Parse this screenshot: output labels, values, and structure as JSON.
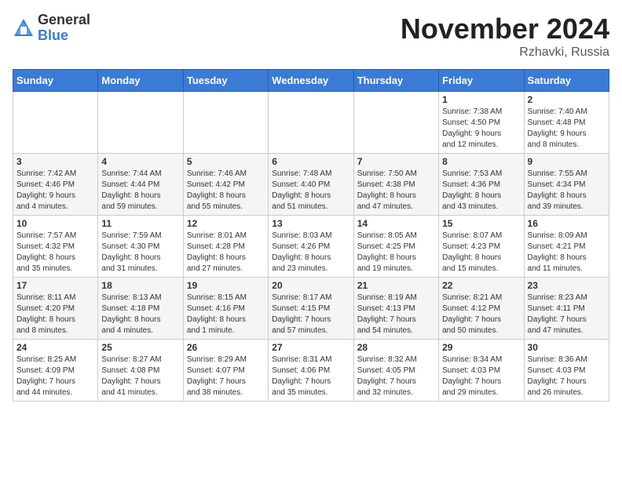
{
  "header": {
    "logo_general": "General",
    "logo_blue": "Blue",
    "month_title": "November 2024",
    "location": "Rzhavki, Russia"
  },
  "weekdays": [
    "Sunday",
    "Monday",
    "Tuesday",
    "Wednesday",
    "Thursday",
    "Friday",
    "Saturday"
  ],
  "weeks": [
    [
      {
        "day": "",
        "info": ""
      },
      {
        "day": "",
        "info": ""
      },
      {
        "day": "",
        "info": ""
      },
      {
        "day": "",
        "info": ""
      },
      {
        "day": "",
        "info": ""
      },
      {
        "day": "1",
        "info": "Sunrise: 7:38 AM\nSunset: 4:50 PM\nDaylight: 9 hours\nand 12 minutes."
      },
      {
        "day": "2",
        "info": "Sunrise: 7:40 AM\nSunset: 4:48 PM\nDaylight: 9 hours\nand 8 minutes."
      }
    ],
    [
      {
        "day": "3",
        "info": "Sunrise: 7:42 AM\nSunset: 4:46 PM\nDaylight: 9 hours\nand 4 minutes."
      },
      {
        "day": "4",
        "info": "Sunrise: 7:44 AM\nSunset: 4:44 PM\nDaylight: 8 hours\nand 59 minutes."
      },
      {
        "day": "5",
        "info": "Sunrise: 7:46 AM\nSunset: 4:42 PM\nDaylight: 8 hours\nand 55 minutes."
      },
      {
        "day": "6",
        "info": "Sunrise: 7:48 AM\nSunset: 4:40 PM\nDaylight: 8 hours\nand 51 minutes."
      },
      {
        "day": "7",
        "info": "Sunrise: 7:50 AM\nSunset: 4:38 PM\nDaylight: 8 hours\nand 47 minutes."
      },
      {
        "day": "8",
        "info": "Sunrise: 7:53 AM\nSunset: 4:36 PM\nDaylight: 8 hours\nand 43 minutes."
      },
      {
        "day": "9",
        "info": "Sunrise: 7:55 AM\nSunset: 4:34 PM\nDaylight: 8 hours\nand 39 minutes."
      }
    ],
    [
      {
        "day": "10",
        "info": "Sunrise: 7:57 AM\nSunset: 4:32 PM\nDaylight: 8 hours\nand 35 minutes."
      },
      {
        "day": "11",
        "info": "Sunrise: 7:59 AM\nSunset: 4:30 PM\nDaylight: 8 hours\nand 31 minutes."
      },
      {
        "day": "12",
        "info": "Sunrise: 8:01 AM\nSunset: 4:28 PM\nDaylight: 8 hours\nand 27 minutes."
      },
      {
        "day": "13",
        "info": "Sunrise: 8:03 AM\nSunset: 4:26 PM\nDaylight: 8 hours\nand 23 minutes."
      },
      {
        "day": "14",
        "info": "Sunrise: 8:05 AM\nSunset: 4:25 PM\nDaylight: 8 hours\nand 19 minutes."
      },
      {
        "day": "15",
        "info": "Sunrise: 8:07 AM\nSunset: 4:23 PM\nDaylight: 8 hours\nand 15 minutes."
      },
      {
        "day": "16",
        "info": "Sunrise: 8:09 AM\nSunset: 4:21 PM\nDaylight: 8 hours\nand 11 minutes."
      }
    ],
    [
      {
        "day": "17",
        "info": "Sunrise: 8:11 AM\nSunset: 4:20 PM\nDaylight: 8 hours\nand 8 minutes."
      },
      {
        "day": "18",
        "info": "Sunrise: 8:13 AM\nSunset: 4:18 PM\nDaylight: 8 hours\nand 4 minutes."
      },
      {
        "day": "19",
        "info": "Sunrise: 8:15 AM\nSunset: 4:16 PM\nDaylight: 8 hours\nand 1 minute."
      },
      {
        "day": "20",
        "info": "Sunrise: 8:17 AM\nSunset: 4:15 PM\nDaylight: 7 hours\nand 57 minutes."
      },
      {
        "day": "21",
        "info": "Sunrise: 8:19 AM\nSunset: 4:13 PM\nDaylight: 7 hours\nand 54 minutes."
      },
      {
        "day": "22",
        "info": "Sunrise: 8:21 AM\nSunset: 4:12 PM\nDaylight: 7 hours\nand 50 minutes."
      },
      {
        "day": "23",
        "info": "Sunrise: 8:23 AM\nSunset: 4:11 PM\nDaylight: 7 hours\nand 47 minutes."
      }
    ],
    [
      {
        "day": "24",
        "info": "Sunrise: 8:25 AM\nSunset: 4:09 PM\nDaylight: 7 hours\nand 44 minutes."
      },
      {
        "day": "25",
        "info": "Sunrise: 8:27 AM\nSunset: 4:08 PM\nDaylight: 7 hours\nand 41 minutes."
      },
      {
        "day": "26",
        "info": "Sunrise: 8:29 AM\nSunset: 4:07 PM\nDaylight: 7 hours\nand 38 minutes."
      },
      {
        "day": "27",
        "info": "Sunrise: 8:31 AM\nSunset: 4:06 PM\nDaylight: 7 hours\nand 35 minutes."
      },
      {
        "day": "28",
        "info": "Sunrise: 8:32 AM\nSunset: 4:05 PM\nDaylight: 7 hours\nand 32 minutes."
      },
      {
        "day": "29",
        "info": "Sunrise: 8:34 AM\nSunset: 4:03 PM\nDaylight: 7 hours\nand 29 minutes."
      },
      {
        "day": "30",
        "info": "Sunrise: 8:36 AM\nSunset: 4:03 PM\nDaylight: 7 hours\nand 26 minutes."
      }
    ]
  ]
}
